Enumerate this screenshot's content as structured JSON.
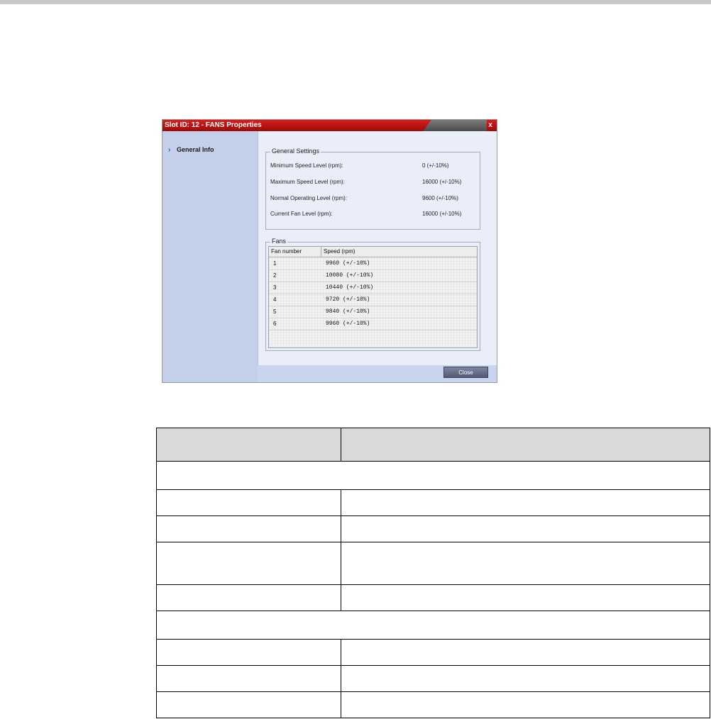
{
  "dialog": {
    "title": "Slot ID: 12 - FANS Properties",
    "close_x": "x",
    "nav": {
      "label": "General Info"
    },
    "general_settings": {
      "title": "General Settings",
      "rows": [
        {
          "label": "Minimum Speed Level (rpm):",
          "value": "0  (+/-10%)"
        },
        {
          "label": "Maximum Speed Level (rpm):",
          "value": "16000  (+/-10%)"
        },
        {
          "label": "Normal Operating Level (rpm):",
          "value": "9600  (+/-10%)"
        },
        {
          "label": "Current Fan Level (rpm):",
          "value": "16000  (+/-10%)"
        }
      ]
    },
    "fans": {
      "title": "Fans",
      "columns": [
        "Fan number",
        "Speed (rpm)"
      ],
      "rows": [
        {
          "num": "1",
          "speed": "9960  (+/-10%)"
        },
        {
          "num": "2",
          "speed": "10080  (+/-10%)"
        },
        {
          "num": "3",
          "speed": "10440  (+/-10%)"
        },
        {
          "num": "4",
          "speed": "9720  (+/-10%)"
        },
        {
          "num": "5",
          "speed": "9840  (+/-10%)"
        },
        {
          "num": "6",
          "speed": "9960  (+/-10%)"
        }
      ]
    },
    "close_button": "Close"
  }
}
